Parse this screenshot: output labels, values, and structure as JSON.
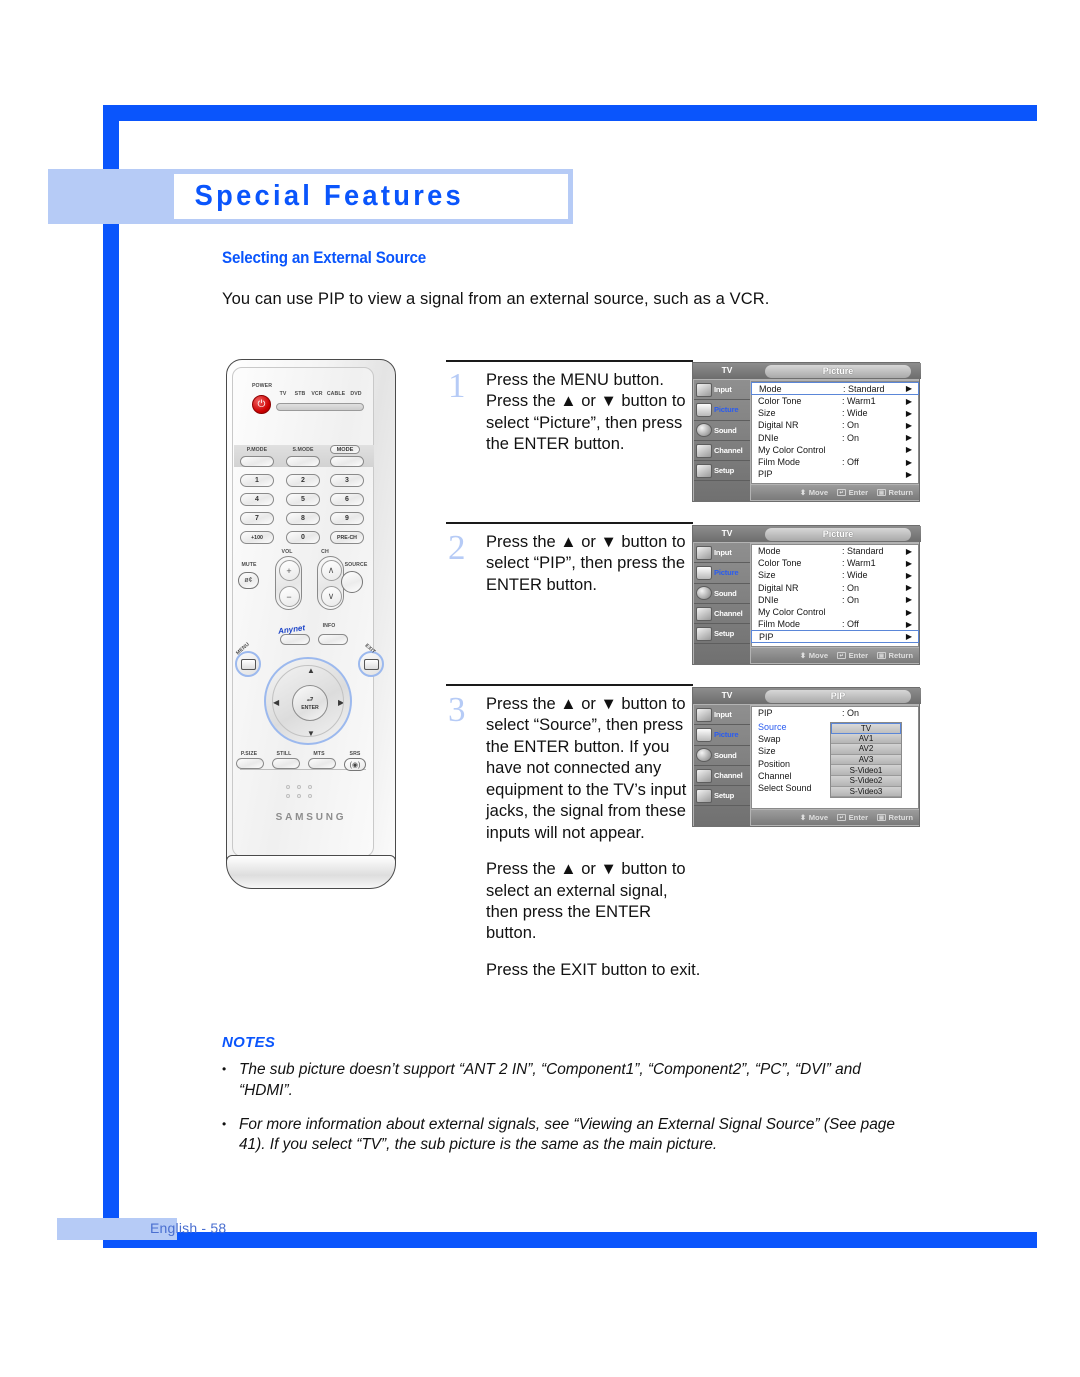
{
  "colors": {
    "brand_blue": "#0a55fc",
    "light_blue": "#b6cbf6",
    "osd_select_blue": "#2a5cf0"
  },
  "chapter": {
    "title": "Special Features"
  },
  "section": {
    "heading": "Selecting an External Source",
    "intro": "You can use PIP to view a signal from an external source, such as a VCR."
  },
  "remote": {
    "brand": "SAMSUNG",
    "power_label": "POWER",
    "power_glyph": "⏻",
    "device_buttons": [
      "TV",
      "STB",
      "VCR",
      "CABLE",
      "DVD"
    ],
    "mode_row": [
      "P.MODE",
      "S.MODE",
      "MODE"
    ],
    "numpad": [
      "1",
      "2",
      "3",
      "4",
      "5",
      "6",
      "7",
      "8",
      "9",
      "+100",
      "0",
      "PRE-CH"
    ],
    "vol_label": "VOL",
    "ch_label": "CH",
    "mute_label": "MUTE",
    "mute_glyph": "ø¢",
    "source_label": "SOURCE",
    "anynet_label": "Anynet",
    "info_label": "INFO",
    "menu_label": "MENU",
    "exit_label": "EXIT",
    "enter_label": "ENTER",
    "enter_glyph": "⮐",
    "vol_plus": "+",
    "vol_minus": "−",
    "ch_up": "∧",
    "ch_down": "∨",
    "nav_up": "▲",
    "nav_down": "▼",
    "nav_left": "◀",
    "nav_right": "▶",
    "bottom_row": [
      "P.SIZE",
      "STILL",
      "MTS",
      "SRS"
    ],
    "srs_glyph": "(◉)"
  },
  "steps": [
    {
      "number": "1",
      "paragraphs": [
        "Press the MENU button. Press the ▲ or ▼ button to select “Picture”, then press the ENTER button."
      ]
    },
    {
      "number": "2",
      "paragraphs": [
        "Press the ▲ or ▼ button to select “PIP”, then press the ENTER button."
      ]
    },
    {
      "number": "3",
      "paragraphs": [
        "Press the ▲ or ▼ button to select “Source”, then press the ENTER button. If you have not connected any equipment to the TV’s input jacks, the signal from these inputs will not appear.",
        "Press the ▲ or ▼ button to select an external signal, then press the ENTER button.",
        "Press the EXIT button to exit."
      ]
    }
  ],
  "osd_common": {
    "source_indicator": "TV",
    "sidebar": [
      {
        "label": "Input",
        "icon": "input-icon",
        "selected": false
      },
      {
        "label": "Picture",
        "icon": "picture-icon",
        "selected": true
      },
      {
        "label": "Sound",
        "icon": "sound-icon",
        "selected": false
      },
      {
        "label": "Channel",
        "icon": "channel-icon",
        "selected": false
      },
      {
        "label": "Setup",
        "icon": "setup-icon",
        "selected": false
      }
    ],
    "footer": [
      {
        "label": "Move",
        "icon": "updown-icon"
      },
      {
        "label": "Enter",
        "icon": "enter-icon"
      },
      {
        "label": "Return",
        "icon": "return-icon"
      }
    ],
    "arrow_glyph": "▶",
    "move_glyph": "⬍"
  },
  "osd_menus": [
    {
      "title": "Picture",
      "highlight_index": 0,
      "rows": [
        {
          "name": "Mode",
          "value": ": Standard"
        },
        {
          "name": "Color Tone",
          "value": ": Warm1"
        },
        {
          "name": "Size",
          "value": ": Wide"
        },
        {
          "name": "Digital NR",
          "value": ": On"
        },
        {
          "name": "DNIe",
          "value": ": On"
        },
        {
          "name": "My Color Control",
          "value": ""
        },
        {
          "name": "Film Mode",
          "value": ": Off"
        },
        {
          "name": "PIP",
          "value": ""
        }
      ]
    },
    {
      "title": "Picture",
      "highlight_index": 7,
      "rows": [
        {
          "name": "Mode",
          "value": ": Standard"
        },
        {
          "name": "Color Tone",
          "value": ": Warm1"
        },
        {
          "name": "Size",
          "value": ": Wide"
        },
        {
          "name": "Digital NR",
          "value": ": On"
        },
        {
          "name": "DNIe",
          "value": ": On"
        },
        {
          "name": "My Color Control",
          "value": ""
        },
        {
          "name": "Film Mode",
          "value": ": Off"
        },
        {
          "name": "PIP",
          "value": ""
        }
      ]
    }
  ],
  "pip_menu": {
    "title": "PIP",
    "pip_row": {
      "name": "PIP",
      "value": ": On"
    },
    "items": [
      {
        "name": "Source",
        "selected": true
      },
      {
        "name": "Swap",
        "selected": false
      },
      {
        "name": "Size",
        "selected": false
      },
      {
        "name": "Position",
        "selected": false
      },
      {
        "name": "Channel",
        "selected": false
      },
      {
        "name": "Select Sound",
        "selected": false
      }
    ],
    "source_options": [
      {
        "label": "TV",
        "selected": true
      },
      {
        "label": "AV1",
        "selected": false
      },
      {
        "label": "AV2",
        "selected": false
      },
      {
        "label": "AV3",
        "selected": false
      },
      {
        "label": "S-Video1",
        "selected": false
      },
      {
        "label": "S-Video2",
        "selected": false
      },
      {
        "label": "S-Video3",
        "selected": false
      }
    ]
  },
  "notes": {
    "title": "NOTES",
    "bullet": "•",
    "items": [
      "The sub picture doesn’t support “ANT 2 IN”, “Component1”, “Component2”, “PC”, “DVI” and “HDMI”.",
      "For more information about external signals, see “Viewing an External Signal Source” (See page 41).  If you select “TV”, the sub picture is the same as the main picture."
    ]
  },
  "footer": {
    "page_label": "English - 58"
  }
}
